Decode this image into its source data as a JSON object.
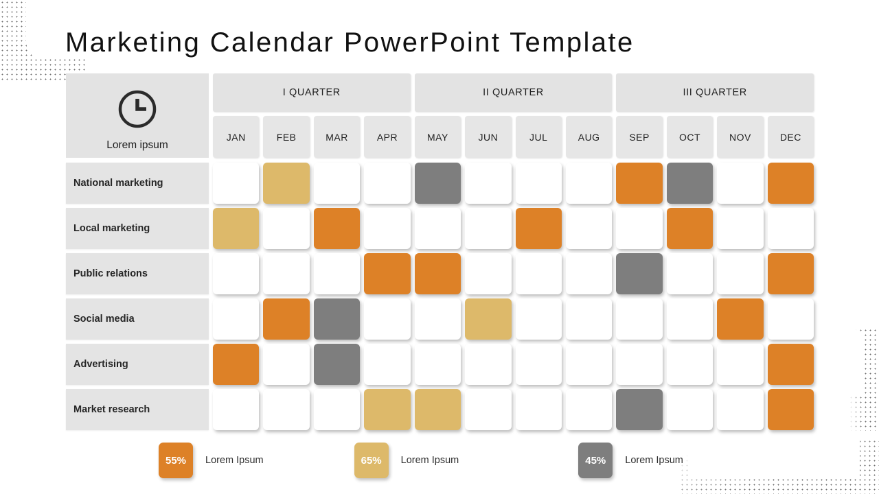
{
  "page_title": "Marketing Calendar PowerPoint Template",
  "corner": {
    "icon": "clock-icon",
    "label": "Lorem ipsum"
  },
  "quarters": [
    {
      "label": "I  QUARTER"
    },
    {
      "label": "II  QUARTER"
    },
    {
      "label": "III  QUARTER"
    }
  ],
  "months": [
    "JAN",
    "FEB",
    "MAR",
    "APR",
    "MAY",
    "JUN",
    "JUL",
    "AUG",
    "SEP",
    "OCT",
    "NOV",
    "DEC"
  ],
  "colors": {
    "orange": "#dd8127",
    "tan": "#ddb96a",
    "gray": "#7e7e7e",
    "white": "#ffffff",
    "header_band": "#e3e3e3",
    "row_label_band": "#e4e4e4"
  },
  "rows": [
    {
      "label": "National marketing",
      "cells": [
        "white",
        "tan",
        "white",
        "white",
        "gray",
        "white",
        "white",
        "white",
        "orange",
        "gray",
        "white",
        "orange"
      ]
    },
    {
      "label": "Local marketing",
      "cells": [
        "tan",
        "white",
        "orange",
        "white",
        "white",
        "white",
        "orange",
        "white",
        "white",
        "orange",
        "white",
        "white"
      ]
    },
    {
      "label": "Public relations",
      "cells": [
        "white",
        "white",
        "white",
        "orange",
        "orange",
        "white",
        "white",
        "white",
        "gray",
        "white",
        "white",
        "orange"
      ]
    },
    {
      "label": "Social media",
      "cells": [
        "white",
        "orange",
        "gray",
        "white",
        "white",
        "tan",
        "white",
        "white",
        "white",
        "white",
        "orange",
        "white"
      ]
    },
    {
      "label": "Advertising",
      "cells": [
        "orange",
        "white",
        "gray",
        "white",
        "white",
        "white",
        "white",
        "white",
        "white",
        "white",
        "white",
        "orange"
      ]
    },
    {
      "label": "Market research",
      "cells": [
        "white",
        "white",
        "white",
        "tan",
        "tan",
        "white",
        "white",
        "white",
        "gray",
        "white",
        "white",
        "orange"
      ]
    }
  ],
  "legend": [
    {
      "value": "55%",
      "label": "Lorem Ipsum",
      "color": "orange"
    },
    {
      "value": "65%",
      "label": "Lorem Ipsum",
      "color": "tan"
    },
    {
      "value": "45%",
      "label": "Lorem Ipsum",
      "color": "gray"
    }
  ]
}
